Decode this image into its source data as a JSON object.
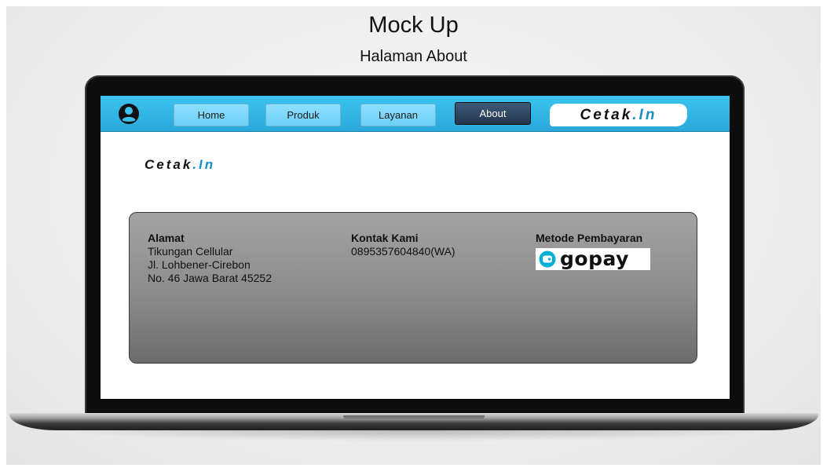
{
  "header": {
    "title": "Mock Up",
    "subtitle": "Halaman About"
  },
  "navbar": {
    "items": [
      {
        "label": "Home",
        "active": false
      },
      {
        "label": "Produk",
        "active": false
      },
      {
        "label": "Layanan",
        "active": false
      },
      {
        "label": "About",
        "active": true
      }
    ],
    "logo": {
      "main": "Cetak",
      "accent": ".In"
    },
    "icon": "user-circle-icon"
  },
  "page": {
    "logo": {
      "main": "Cetak",
      "accent": ".In"
    }
  },
  "info": {
    "alamat": {
      "heading": "Alamat",
      "lines": [
        "Tikungan Cellular",
        "Jl. Lohbener-Cirebon",
        "No. 46 Jawa Barat 45252"
      ]
    },
    "kontak": {
      "heading": "Kontak Kami",
      "lines": [
        "0895357604840(WA)"
      ]
    },
    "pembayaran": {
      "heading": "Metode Pembayaran",
      "logo_text": "gopay",
      "icon": "gopay-wallet-icon"
    }
  },
  "colors": {
    "navbar": "#29a9db",
    "nav_button": "#6bd0f6",
    "nav_active": "#22354c",
    "logo_accent": "#1a8fc6",
    "gopay_blue": "#00aed6"
  }
}
